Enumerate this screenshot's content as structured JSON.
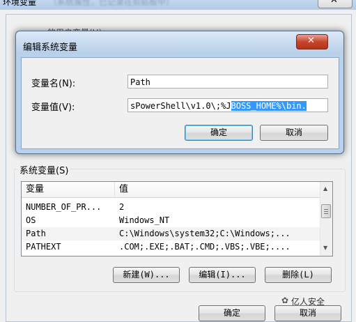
{
  "outer_window": {
    "title": "环境变量",
    "title_suffix_blurred": "（系统属性，已记录在剪贴板中）",
    "close_label": "✕",
    "user_vars_label": "的用户变量(U)"
  },
  "edit_dialog": {
    "title": "编辑系统变量",
    "close_label": "✕",
    "name_label": "变量名(N):",
    "name_value": "Path",
    "value_label": "变量值(V):",
    "value_prefix": "sPowerShell\\v1.0\\;%J",
    "value_selected": "BOSS_HOME%\\bin.",
    "ok_button": "确定",
    "cancel_button": "取消"
  },
  "system_variables": {
    "label": "系统变量(S)",
    "columns": [
      "变量",
      "值"
    ],
    "rows": [
      {
        "name": "NUMBER_OF_PR...",
        "value": "2"
      },
      {
        "name": "OS",
        "value": "Windows_NT"
      },
      {
        "name": "Path",
        "value": "C:\\Windows\\system32;C:\\Windows;..."
      },
      {
        "name": "PATHEXT",
        "value": ".COM;.EXE;.BAT;.CMD;.VBS;.VBE;...."
      }
    ],
    "new_button": "新建(W)...",
    "edit_button": "编辑(I)...",
    "delete_button": "删除(L)"
  },
  "outer_buttons": {
    "ok": "确定",
    "cancel": "取消"
  },
  "watermark": {
    "text": "亿人安全",
    "icon": "wechat-icon"
  }
}
